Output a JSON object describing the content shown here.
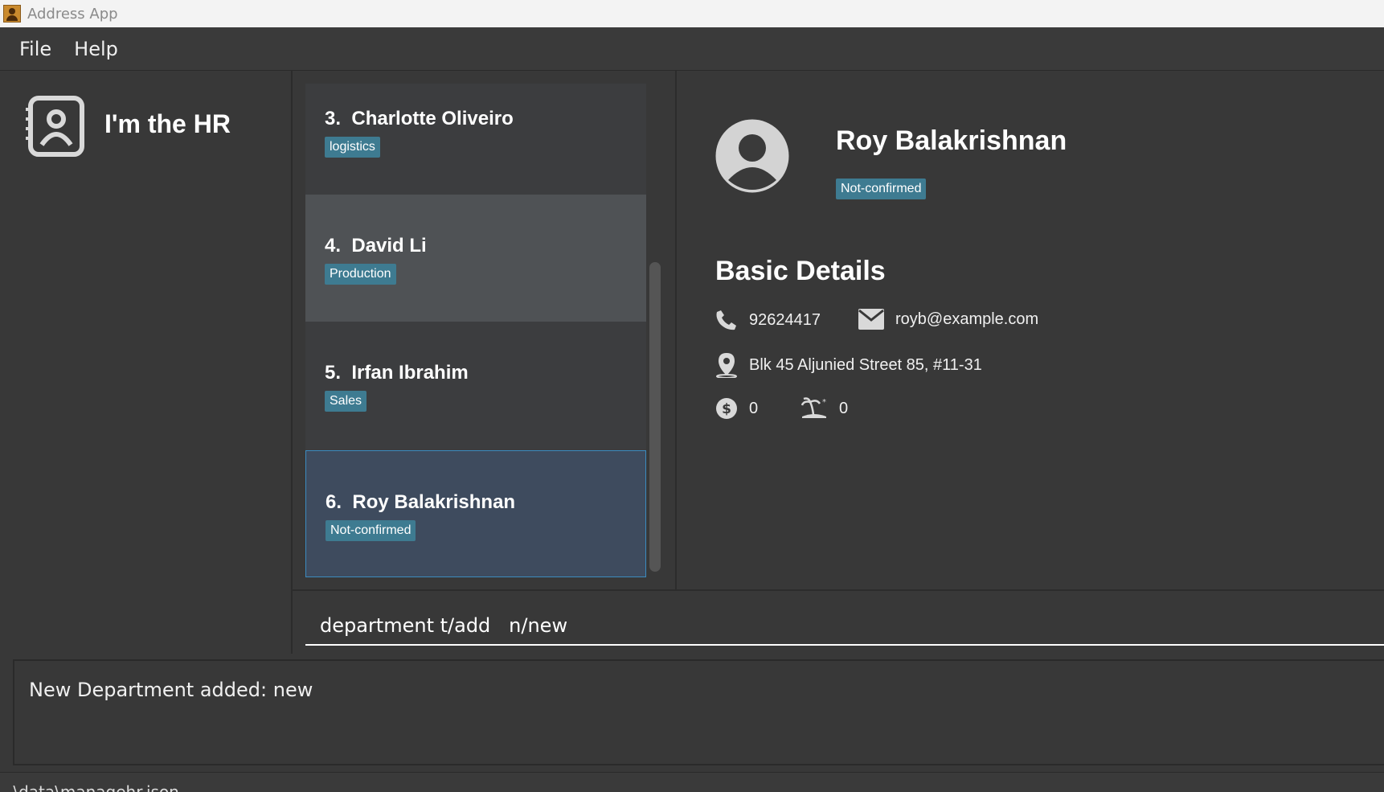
{
  "window": {
    "title": "Address App",
    "app_icon": "address-book-icon"
  },
  "menu": {
    "file": "File",
    "help": "Help"
  },
  "brand": {
    "title": "I'm the HR",
    "icon": "contact-book-icon"
  },
  "list": {
    "items": [
      {
        "index": "3.",
        "name": "Charlotte Oliveiro",
        "tag": "logistics"
      },
      {
        "index": "4.",
        "name": "David Li",
        "tag": "Production"
      },
      {
        "index": "5.",
        "name": "Irfan Ibrahim",
        "tag": "Sales"
      },
      {
        "index": "6.",
        "name": "Roy Balakrishnan",
        "tag": "Not-confirmed"
      }
    ]
  },
  "detail": {
    "name": "Roy Balakrishnan",
    "tag": "Not-confirmed",
    "section_title": "Basic Details",
    "phone": "92624417",
    "email": "royb@example.com",
    "address": "Blk 45 Aljunied Street 85, #11-31",
    "salary": "0",
    "leave": "0"
  },
  "command": {
    "value": "department t/add   n/new"
  },
  "result": {
    "text": "New Department added: new"
  },
  "status": {
    "path": ".\\data\\managehr.json"
  },
  "colors": {
    "tag": "#3e7b91",
    "selected_border": "#3b8bbf",
    "background": "#383838"
  }
}
